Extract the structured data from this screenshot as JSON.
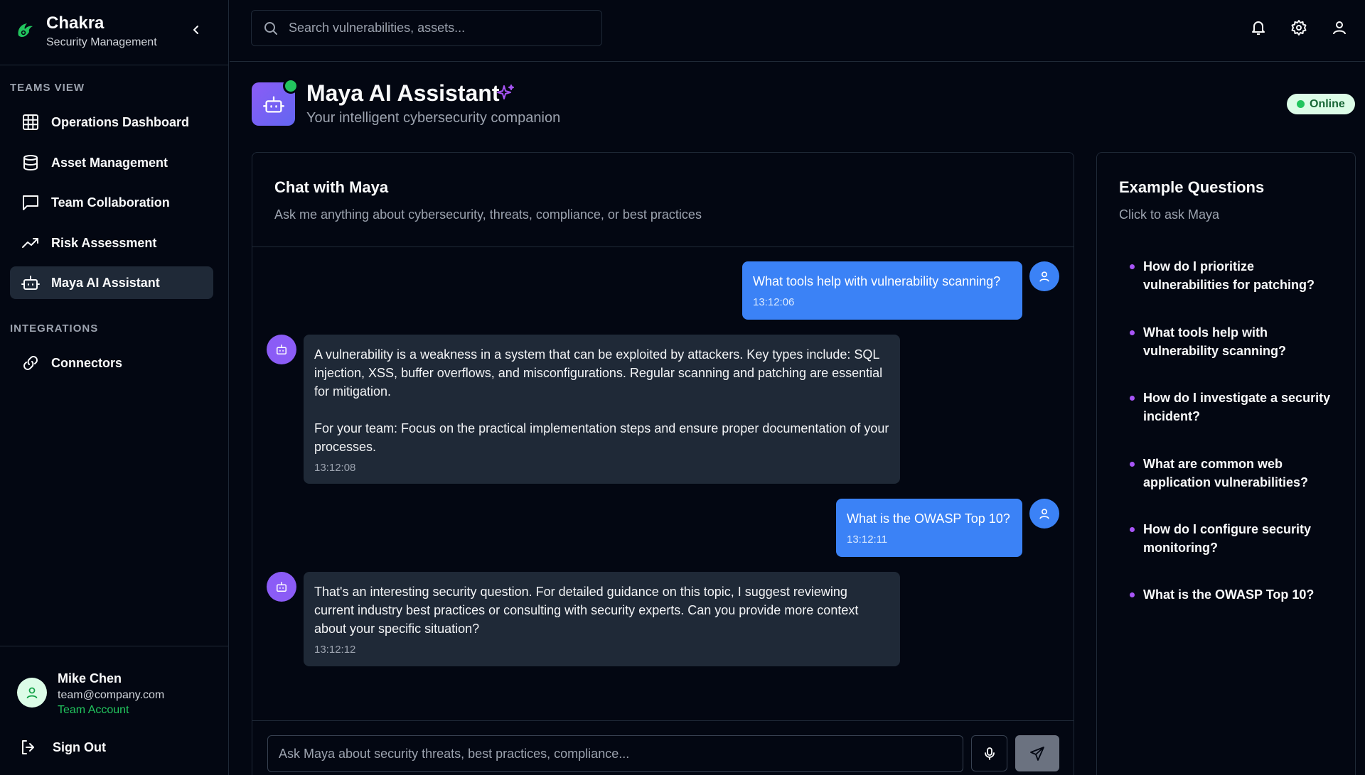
{
  "brand": {
    "name": "Chakra",
    "subtitle": "Security Management"
  },
  "sidebar": {
    "sections": [
      {
        "label": "TEAMS VIEW"
      },
      {
        "label": "INTEGRATIONS"
      }
    ],
    "items": [
      {
        "label": "Operations Dashboard",
        "icon": "grid-icon"
      },
      {
        "label": "Asset Management",
        "icon": "database-icon"
      },
      {
        "label": "Team Collaboration",
        "icon": "chat-square-icon"
      },
      {
        "label": "Risk Assessment",
        "icon": "trending-up-icon"
      },
      {
        "label": "Maya AI Assistant",
        "icon": "robot-icon",
        "active": true
      },
      {
        "label": "Connectors",
        "icon": "link-icon"
      }
    ],
    "user": {
      "name": "Mike Chen",
      "email": "team@company.com",
      "role": "Team Account"
    },
    "sign_out": "Sign Out"
  },
  "search": {
    "placeholder": "Search vulnerabilities, assets..."
  },
  "header": {
    "title": "Maya AI Assistant",
    "subtitle": "Your intelligent cybersecurity companion",
    "status": "Online"
  },
  "chat": {
    "title": "Chat with Maya",
    "description": "Ask me anything about cybersecurity, threats, compliance, or best practices",
    "messages": [
      {
        "role": "user",
        "text": "What tools help with vulnerability scanning?",
        "time": "13:12:06"
      },
      {
        "role": "bot",
        "paragraphs": [
          "A vulnerability is a weakness in a system that can be exploited by attackers. Key types include: SQL injection, XSS, buffer overflows, and misconfigurations. Regular scanning and patching are essential for mitigation.",
          "For your team: Focus on the practical implementation steps and ensure proper documentation of your processes."
        ],
        "time": "13:12:08"
      },
      {
        "role": "user",
        "text": "What is the OWASP Top 10?",
        "time": "13:12:11"
      },
      {
        "role": "bot",
        "paragraphs": [
          "That's an interesting security question. For detailed guidance on this topic, I suggest reviewing current industry best practices or consulting with security experts. Can you provide more context about your specific situation?"
        ],
        "time": "13:12:12"
      }
    ],
    "input_placeholder": "Ask Maya about security threats, best practices, compliance..."
  },
  "examples": {
    "title": "Example Questions",
    "description": "Click to ask Maya",
    "items": [
      "How do I prioritize vulnerabilities for patching?",
      "What tools help with vulnerability scanning?",
      "How do I investigate a security incident?",
      "What are common web application vulnerabilities?",
      "How do I configure security monitoring?",
      "What is the OWASP Top 10?"
    ]
  },
  "colors": {
    "accent": "#3b82f6",
    "brand": "#22c55e",
    "assistant": "#8b5cf6",
    "background": "#030712"
  }
}
